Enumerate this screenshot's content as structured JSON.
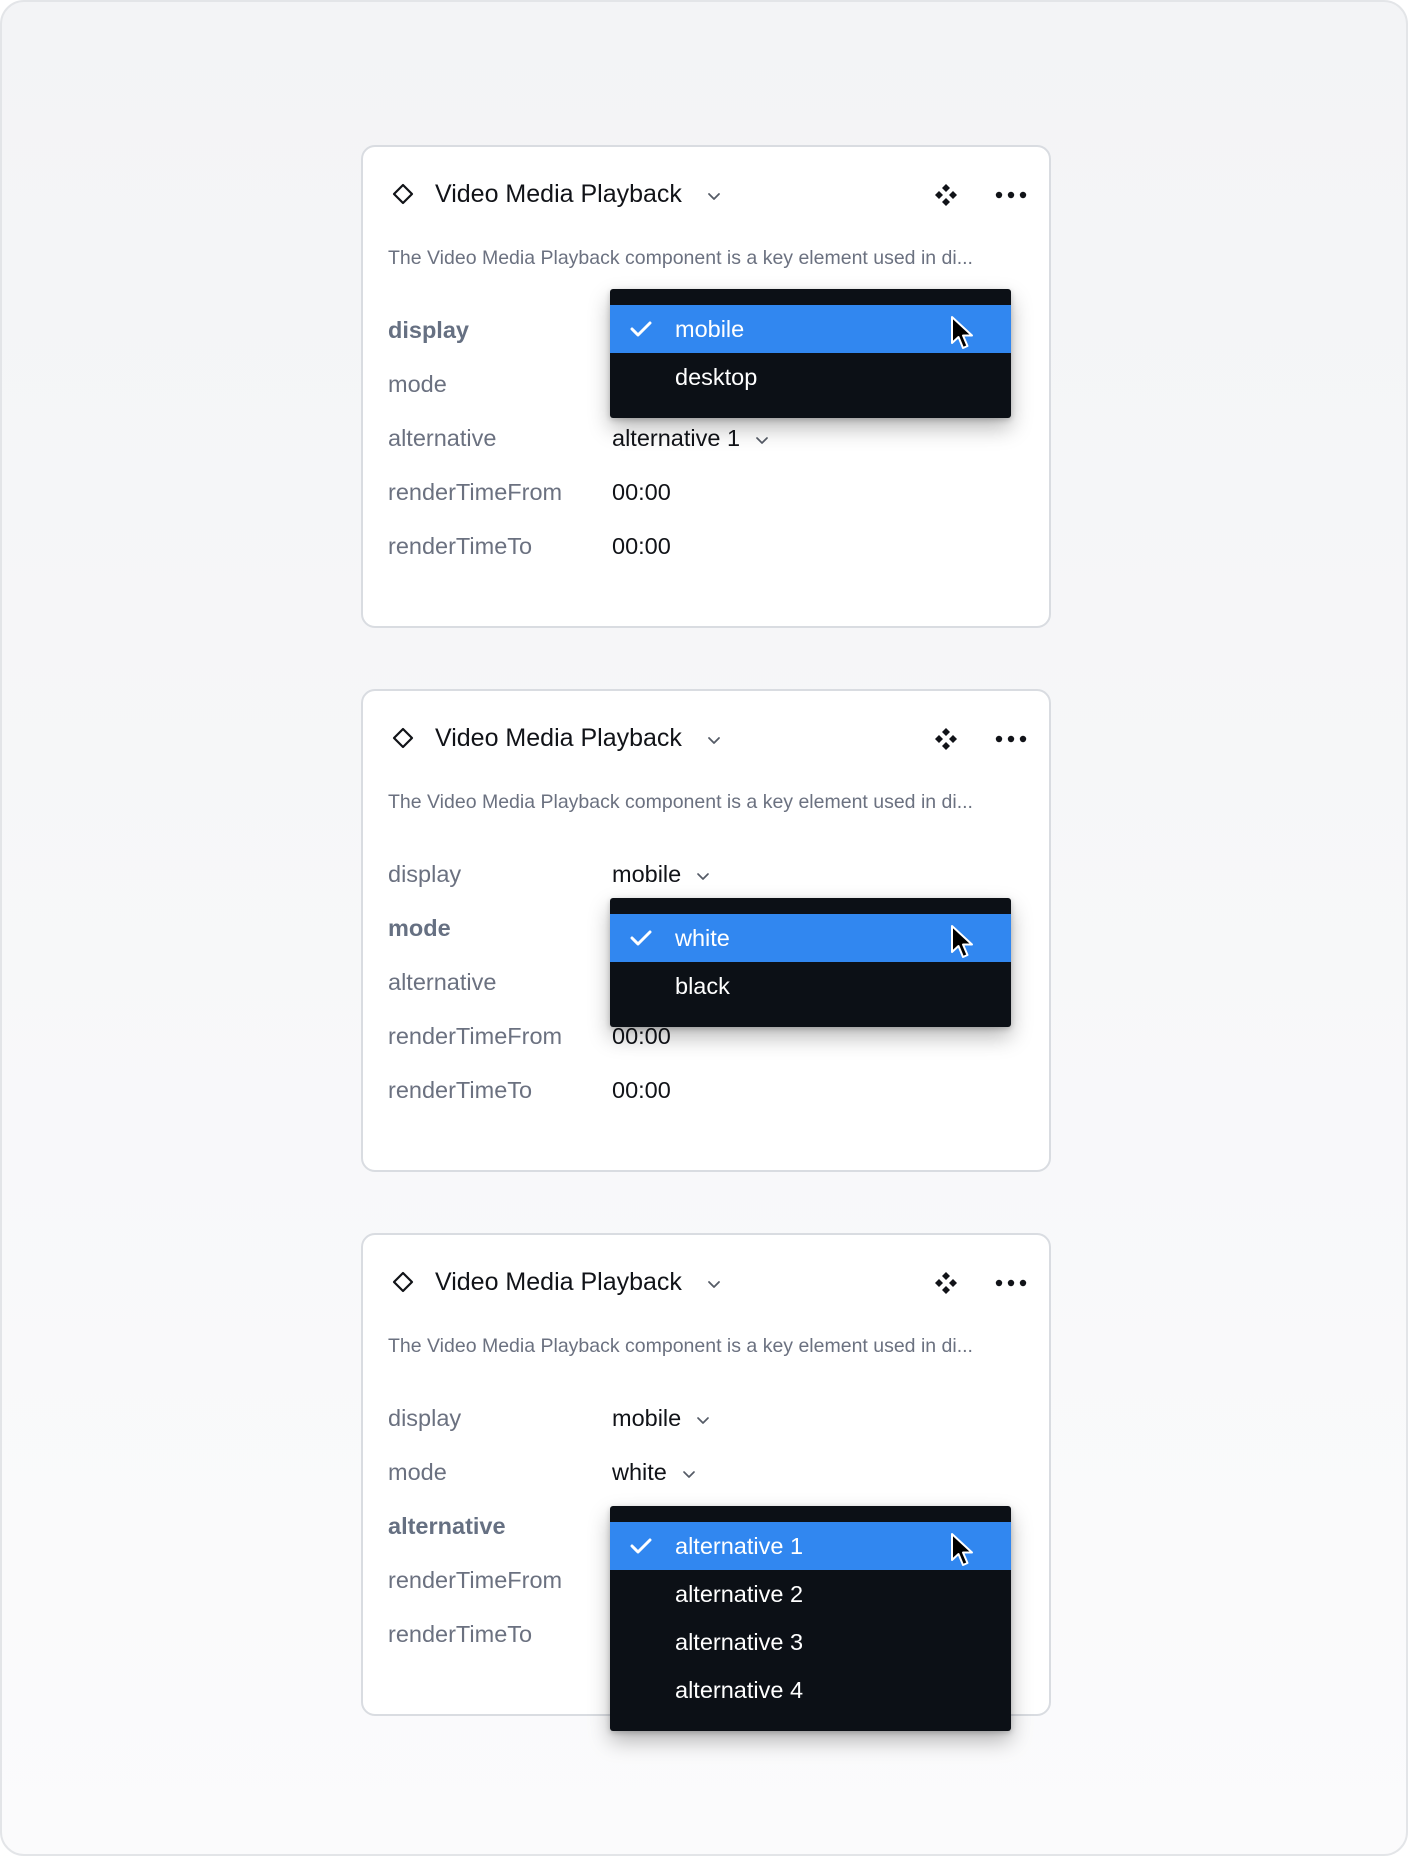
{
  "panels": [
    {
      "title": "Video Media Playback",
      "description": "The Video Media Playback component is a key element used in di...",
      "rows": [
        {
          "label": "display",
          "value": "",
          "active": true
        },
        {
          "label": "mode",
          "value": ""
        },
        {
          "label": "alternative",
          "value": "alternative 1",
          "chevron": true
        },
        {
          "label": "renderTimeFrom",
          "value": "00:00"
        },
        {
          "label": "renderTimeTo",
          "value": "00:00"
        }
      ],
      "dropdown": {
        "options": [
          "mobile",
          "desktop"
        ],
        "selected": "mobile"
      }
    },
    {
      "title": "Video Media Playback",
      "description": "The Video Media Playback component is a key element used in di...",
      "rows": [
        {
          "label": "display",
          "value": "mobile",
          "chevron": true
        },
        {
          "label": "mode",
          "value": "",
          "active": true
        },
        {
          "label": "alternative",
          "value": ""
        },
        {
          "label": "renderTimeFrom",
          "value": "00:00"
        },
        {
          "label": "renderTimeTo",
          "value": "00:00"
        }
      ],
      "dropdown": {
        "options": [
          "white",
          "black"
        ],
        "selected": "white"
      }
    },
    {
      "title": "Video Media Playback",
      "description": "The Video Media Playback component is a key element used in di...",
      "rows": [
        {
          "label": "display",
          "value": "mobile",
          "chevron": true
        },
        {
          "label": "mode",
          "value": "white",
          "chevron": true
        },
        {
          "label": "alternative",
          "value": "",
          "active": true
        },
        {
          "label": "renderTimeFrom",
          "value": ""
        },
        {
          "label": "renderTimeTo",
          "value": ""
        }
      ],
      "dropdown": {
        "options": [
          "alternative 1",
          "alternative 2",
          "alternative 3",
          "alternative 4"
        ],
        "selected": "alternative 1"
      }
    }
  ],
  "icons": {
    "component": "diamond-outline-icon",
    "title_chevron": "chevron-down-icon",
    "variants": "component-variants-icon",
    "more": "more-horizontal-icon",
    "check": "check-icon",
    "cursor": "mouse-pointer-icon"
  },
  "colors": {
    "selected_option": "#3187f0",
    "dropdown_bg": "#0c1016",
    "label": "#6b7180",
    "value": "#111318"
  }
}
